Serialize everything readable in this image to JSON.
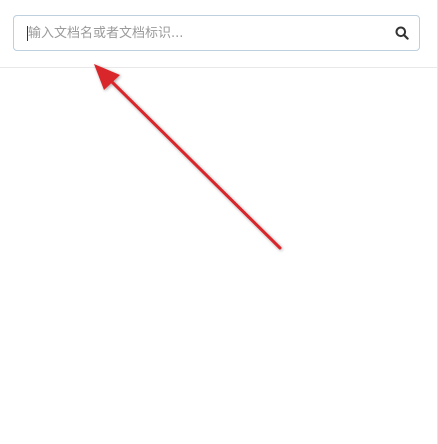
{
  "search": {
    "placeholder": "输入文档名或者文档标识...",
    "value": "",
    "icon": "search-icon"
  },
  "annotation": {
    "arrow_color": "#d8262c",
    "icon": "arrow-annotation"
  },
  "colors": {
    "input_border": "#bcd0e0",
    "divider": "#e8e8e8"
  }
}
